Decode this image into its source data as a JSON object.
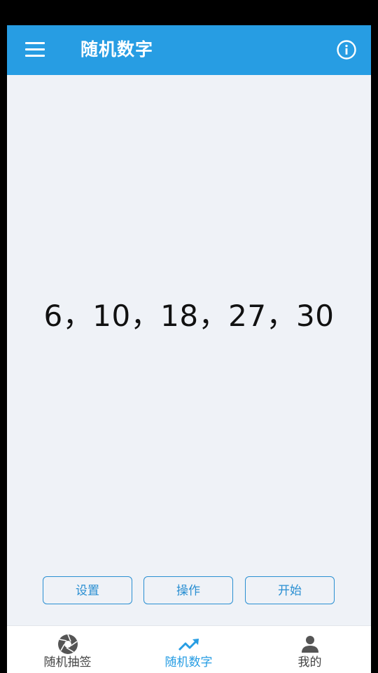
{
  "header": {
    "title": "随机数字"
  },
  "result": {
    "numbers": "6，10，18，27，30"
  },
  "actions": {
    "settings_label": "设置",
    "operate_label": "操作",
    "start_label": "开始"
  },
  "bottom_nav": {
    "items": [
      {
        "label": "随机抽签",
        "icon": "aperture-icon",
        "active": false
      },
      {
        "label": "随机数字",
        "icon": "trending-up-icon",
        "active": true
      },
      {
        "label": "我的",
        "icon": "person-icon",
        "active": false
      }
    ]
  },
  "colors": {
    "primary": "#279de3",
    "background": "#eff2f7",
    "button_border": "#2a8fd2",
    "inactive_nav": "#444444"
  }
}
